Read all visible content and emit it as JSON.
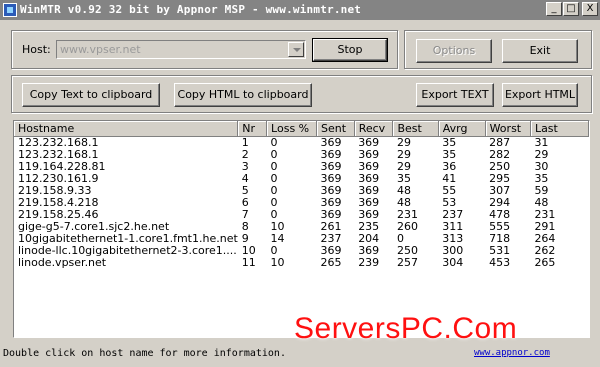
{
  "window": {
    "title": "WinMTR v0.92 32 bit by Appnor MSP - www.winmtr.net",
    "controls": {
      "minimize": "_",
      "maximize": "□",
      "close": "X"
    }
  },
  "toolbar": {
    "host_label": "Host:",
    "host_value": "www.vpser.net",
    "stop_label": "Stop",
    "options_label": "Options",
    "exit_label": "Exit"
  },
  "actions": {
    "copy_text": "Copy Text to clipboard",
    "copy_html": "Copy HTML to clipboard",
    "export_text": "Export TEXT",
    "export_html": "Export HTML"
  },
  "table": {
    "columns": [
      "Hostname",
      "Nr",
      "Loss %",
      "Sent",
      "Recv",
      "Best",
      "Avrg",
      "Worst",
      "Last"
    ],
    "rows": [
      [
        "123.232.168.1",
        "1",
        "0",
        "369",
        "369",
        "29",
        "35",
        "287",
        "31"
      ],
      [
        "123.232.168.1",
        "2",
        "0",
        "369",
        "369",
        "29",
        "35",
        "282",
        "29"
      ],
      [
        "119.164.228.81",
        "3",
        "0",
        "369",
        "369",
        "29",
        "36",
        "250",
        "30"
      ],
      [
        "112.230.161.9",
        "4",
        "0",
        "369",
        "369",
        "35",
        "41",
        "295",
        "35"
      ],
      [
        "219.158.9.33",
        "5",
        "0",
        "369",
        "369",
        "48",
        "55",
        "307",
        "59"
      ],
      [
        "219.158.4.218",
        "6",
        "0",
        "369",
        "369",
        "48",
        "53",
        "294",
        "48"
      ],
      [
        "219.158.25.46",
        "7",
        "0",
        "369",
        "369",
        "231",
        "237",
        "478",
        "231"
      ],
      [
        "gige-g5-7.core1.sjc2.he.net",
        "8",
        "10",
        "261",
        "235",
        "260",
        "311",
        "555",
        "291"
      ],
      [
        "10gigabitethernet1-1.core1.fmt1.he.net",
        "9",
        "14",
        "237",
        "204",
        "0",
        "313",
        "718",
        "264"
      ],
      [
        "linode-llc.10gigabitethernet2-3.core1....",
        "10",
        "0",
        "369",
        "369",
        "250",
        "300",
        "531",
        "262"
      ],
      [
        "linode.vpser.net",
        "11",
        "10",
        "265",
        "239",
        "257",
        "304",
        "453",
        "265"
      ]
    ]
  },
  "status": {
    "message": "Double click on host name for more information.",
    "link": "www.appnor.com"
  },
  "watermark": "ServersPC.Com"
}
